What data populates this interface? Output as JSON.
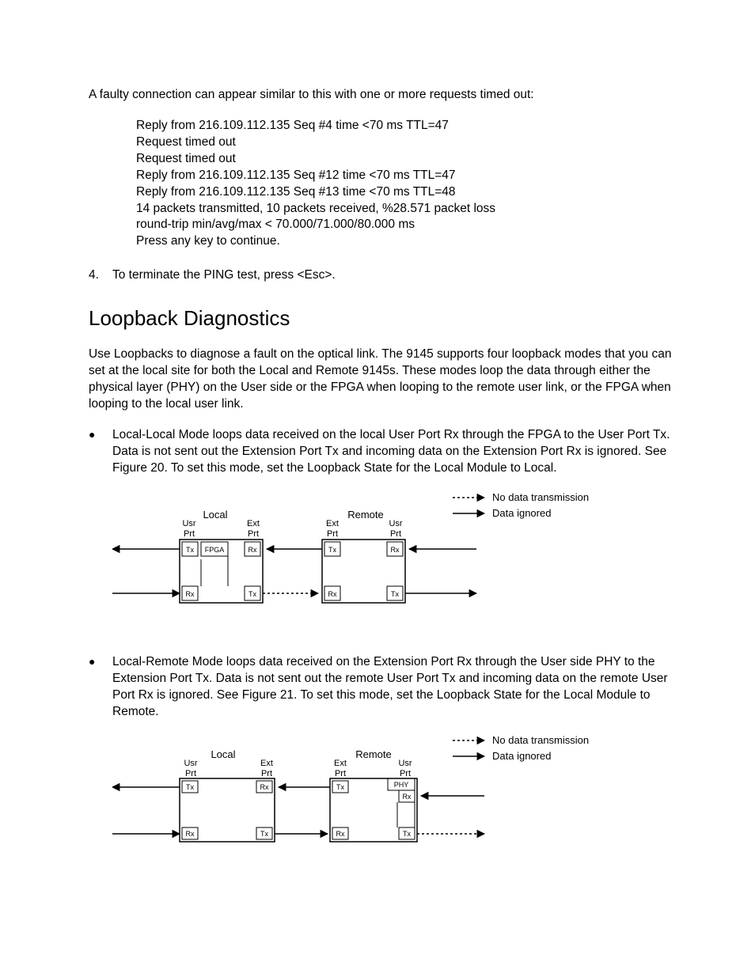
{
  "intro_line": "A faulty connection can appear similar to this with one or more requests timed out:",
  "console": [
    "Reply from 216.109.112.135 Seq #4 time <70 ms TTL=47",
    "Request timed out",
    "Request timed out",
    "Reply from 216.109.112.135 Seq #12 time <70 ms TTL=47",
    "Reply from 216.109.112.135 Seq #13 time <70 ms TTL=48",
    "14 packets transmitted, 10 packets received, %28.571 packet loss",
    "round-trip min/avg/max < 70.000/71.000/80.000 ms",
    "Press any key to continue."
  ],
  "step4_num": "4.",
  "step4_text": "To terminate the PING test, press <Esc>.",
  "h2": "Loopback Diagnostics",
  "loopback_intro": "Use Loopbacks to diagnose a fault on the optical link.  The 9145 supports four loopback modes that you can set at the local site for both the Local and Remote 9145s.  These modes loop the data through either the physical layer (PHY) on the User side or the FPGA when looping to the remote user link, or the FPGA when looping to the local user link.",
  "bullet1": "Local-Local Mode loops data received on the local User Port Rx through the FPGA to the User Port Tx.  Data is not sent out the Extension Port Tx and incoming data on the Extension Port Rx is ignored.  See Figure 20.  To set this mode, set the Loopback State for the Local Module to Local.",
  "bullet2": "Local-Remote Mode loops data received on the Extension Port Rx through the User side PHY to the Extension Port Tx.  Data is not sent out the remote User Port Tx and incoming data on the remote User Port Rx is ignored.  See Figure 21.  To set this mode, set the Loopback State for the Local Module to Remote.",
  "diag": {
    "local": "Local",
    "remote": "Remote",
    "usr_prt": "Usr\nPrt",
    "ext_prt": "Ext\nPrt",
    "tx": "Tx",
    "rx": "Rx",
    "fpga": "FPGA",
    "phy": "PHY",
    "legend_no": "No data transmission",
    "legend_ig": "Data ignored"
  }
}
